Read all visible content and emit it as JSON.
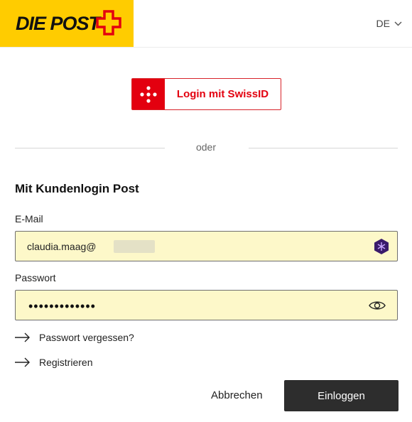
{
  "header": {
    "logo_text": "DIE POST",
    "language": "DE"
  },
  "swissid": {
    "label": "Login mit SwissID"
  },
  "separator": {
    "text": "oder"
  },
  "form": {
    "title": "Mit Kundenlogin Post",
    "email_label": "E-Mail",
    "email_value": "claudia.maag@",
    "password_label": "Passwort",
    "password_value": "•••••••••••••"
  },
  "links": {
    "forgot_password": "Passwort vergessen?",
    "register": "Registrieren"
  },
  "actions": {
    "cancel": "Abbrechen",
    "login": "Einloggen"
  },
  "colors": {
    "brand_yellow": "#ffcc00",
    "brand_red": "#e3000f",
    "field_bg": "#fdf8c9",
    "primary_button": "#2d2d2d"
  },
  "icons": {
    "logo": "swiss-post-cross-icon",
    "language": "chevron-down-icon",
    "swissid": "swissid-dots-icon",
    "email_trailing": "password-manager-icon",
    "password_trailing": "eye-icon",
    "link": "arrow-right-icon"
  }
}
